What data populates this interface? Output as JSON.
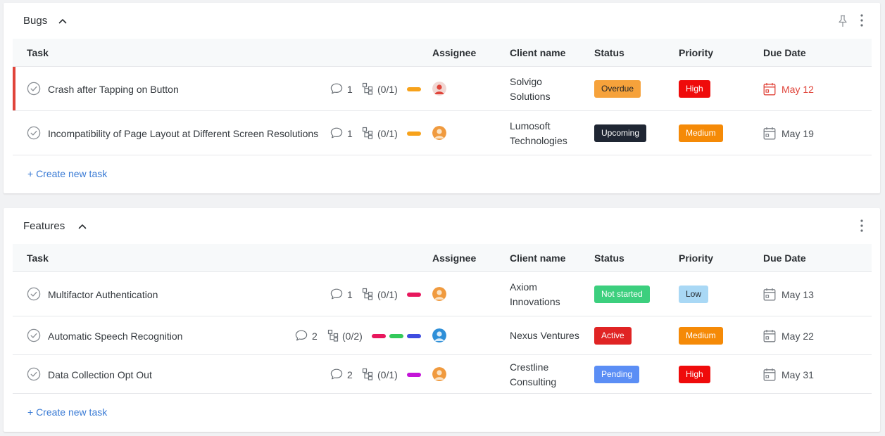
{
  "columns": {
    "task": "Task",
    "assignee": "Assignee",
    "client": "Client name",
    "status": "Status",
    "priority": "Priority",
    "due": "Due Date"
  },
  "colors": {
    "overdue_text": "#e0443a",
    "link": "#3a7bd5"
  },
  "bugs": {
    "title": "Bugs",
    "create": "+ Create new task",
    "rows": [
      {
        "name": "Crash after Tapping on Button",
        "comments": "1",
        "subtasks": "(0/1)",
        "client_line1": "Solvigo",
        "client_line2": "Solutions",
        "status": "Overdue",
        "priority": "High",
        "due": "May 12"
      },
      {
        "name": "Incompatibility of Page Layout at Different Screen Resolutions",
        "comments": "1",
        "subtasks": "(0/1)",
        "client_line1": "Lumosoft",
        "client_line2": "Technologies",
        "status": "Upcoming",
        "priority": "Medium",
        "due": "May 19"
      }
    ]
  },
  "features": {
    "title": "Features",
    "create": "+ Create new task",
    "rows": [
      {
        "name": "Multifactor Authentication",
        "comments": "1",
        "subtasks": "(0/1)",
        "client_line1": "Axiom",
        "client_line2": "Innovations",
        "status": "Not started",
        "priority": "Low",
        "due": "May 13"
      },
      {
        "name": "Automatic Speech Recognition",
        "comments": "2",
        "subtasks": "(0/2)",
        "client_line1": "Nexus Ventures",
        "client_line2": "",
        "status": "Active",
        "priority": "Medium",
        "due": "May 22"
      },
      {
        "name": "Data Collection Opt Out",
        "comments": "2",
        "subtasks": "(0/1)",
        "client_line1": "Crestline",
        "client_line2": "Consulting",
        "status": "Pending",
        "priority": "High",
        "due": "May 31"
      }
    ]
  }
}
